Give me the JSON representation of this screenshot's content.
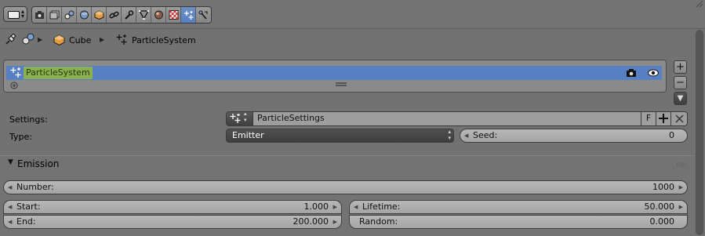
{
  "header": {
    "editor_icon": "properties-editor-icon",
    "tabs": [
      {
        "name": "render-icon",
        "active": false
      },
      {
        "name": "render-layers-icon",
        "active": false
      },
      {
        "name": "scene-icon",
        "active": false
      },
      {
        "name": "world-icon",
        "active": false
      },
      {
        "name": "object-icon",
        "active": false
      },
      {
        "name": "constraints-icon",
        "active": false
      },
      {
        "name": "modifiers-icon",
        "active": false
      },
      {
        "name": "data-icon",
        "active": false
      },
      {
        "name": "material-icon",
        "active": false
      },
      {
        "name": "texture-icon",
        "active": false
      },
      {
        "name": "particles-icon",
        "active": true
      },
      {
        "name": "physics-icon",
        "active": false
      }
    ]
  },
  "breadcrumb": {
    "object": "Cube",
    "particle_system": "ParticleSystem"
  },
  "particle_list": {
    "items": [
      {
        "name": "ParticleSystem",
        "selected": true
      }
    ],
    "add_symbol": "+",
    "remove_symbol": "−",
    "menu_symbol": "▼"
  },
  "settings": {
    "label": "Settings:",
    "value": "ParticleSettings",
    "fake_user": "F"
  },
  "type": {
    "label": "Type:",
    "value": "Emitter"
  },
  "seed": {
    "label": "Seed:",
    "value": "0"
  },
  "emission": {
    "title": "Emission",
    "number_label": "Number:",
    "number_value": "1000",
    "start_label": "Start:",
    "start_value": "1.000",
    "end_label": "End:",
    "end_value": "200.000",
    "lifetime_label": "Lifetime:",
    "lifetime_value": "50.000",
    "random_label": "Random:",
    "random_value": "0.000"
  },
  "colors": {
    "selection": "#5680c2",
    "name_highlight": "#8cb050",
    "panel_bg": "#727272"
  }
}
